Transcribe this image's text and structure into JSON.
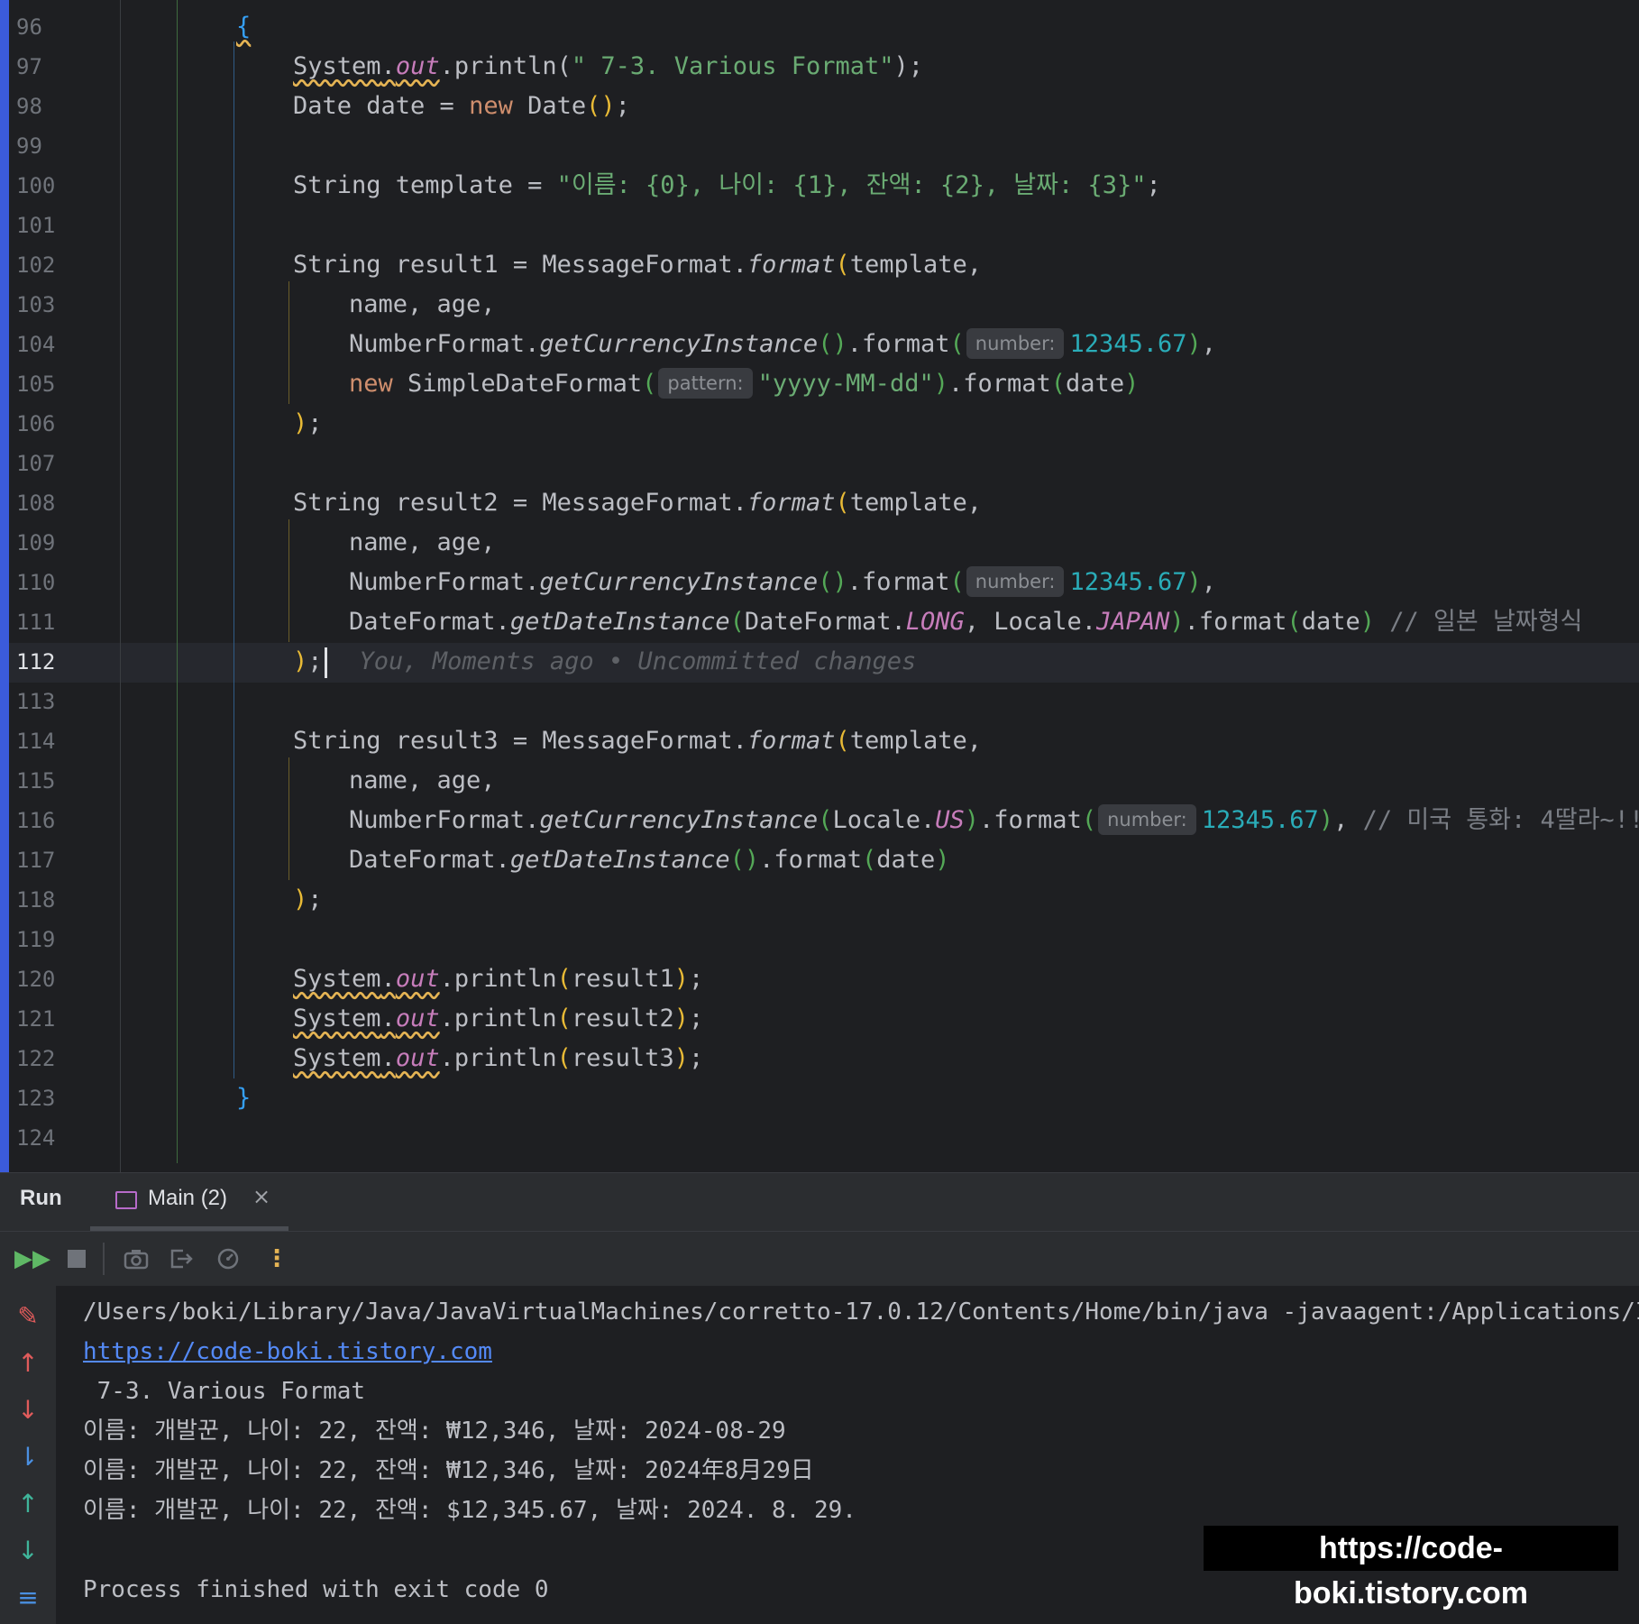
{
  "editor": {
    "line_numbers": [
      "96",
      "97",
      "98",
      "99",
      "100",
      "101",
      "102",
      "103",
      "104",
      "105",
      "106",
      "107",
      "108",
      "109",
      "110",
      "111",
      "112",
      "113",
      "114",
      "115",
      "116",
      "117",
      "118",
      "119",
      "120",
      "121",
      "122",
      "123",
      "124"
    ],
    "current_line": "112",
    "blame_hint": "You, Moments ago • Uncommitted changes",
    "inlay_hints": {
      "number": "number:",
      "pattern": "pattern:"
    },
    "lines": {
      "l96": "{",
      "l97": [
        "System",
        ".",
        "out",
        ".println(",
        "\" 7-3. Various Format\"",
        ");"
      ],
      "l98": [
        "Date date = ",
        "new",
        " Date",
        "()",
        ";"
      ],
      "l100": [
        "String template = ",
        "\"이름: {0}, 나이: {1}, 잔액: {2}, 날짜: {3}\"",
        ";"
      ],
      "l102": [
        "String result1 = MessageFormat.",
        "format",
        "(",
        "template,"
      ],
      "l103": "name, age,",
      "l104": [
        "NumberFormat.",
        "getCurrencyInstance",
        "()",
        ".format",
        "(",
        "12345.67",
        ")",
        ","
      ],
      "l105": [
        "new",
        " SimpleDateFormat",
        "(",
        "\"yyyy-MM-dd\"",
        ")",
        ".format",
        "(",
        "date",
        ")"
      ],
      "l106": [
        ")",
        ";"
      ],
      "l108": [
        "String result2 = MessageFormat.",
        "format",
        "(",
        "template,"
      ],
      "l109": "name, age,",
      "l110": [
        "NumberFormat.",
        "getCurrencyInstance",
        "()",
        ".format",
        "(",
        "12345.67",
        ")",
        ","
      ],
      "l111": [
        "DateFormat.",
        "getDateInstance",
        "(",
        "DateFormat.",
        "LONG",
        ", Locale.",
        "JAPAN",
        ")",
        ".format",
        "(",
        "date",
        ")",
        " // 일본 날짜형식"
      ],
      "l112": [
        ")",
        ";"
      ],
      "l114": [
        "String result3 = MessageFormat.",
        "format",
        "(",
        "template,"
      ],
      "l115": "name, age,",
      "l116": [
        "NumberFormat.",
        "getCurrencyInstance",
        "(",
        "Locale.",
        "US",
        ")",
        ".format",
        "(",
        "12345.67",
        ")",
        ", ",
        "// 미국 통화: 4딸라~!!"
      ],
      "l117": [
        "DateFormat.",
        "getDateInstance",
        "()",
        ".format",
        "(",
        "date",
        ")"
      ],
      "l118": [
        ")",
        ";"
      ],
      "l120": [
        "System",
        ".",
        "out",
        ".println",
        "(",
        "result1",
        ")",
        ";"
      ],
      "l121": [
        "System",
        ".",
        "out",
        ".println",
        "(",
        "result2",
        ")",
        ";"
      ],
      "l122": [
        "System",
        ".",
        "out",
        ".println",
        "(",
        "result3",
        ")",
        ";"
      ],
      "l123": "}"
    }
  },
  "run_panel": {
    "title": "Run",
    "tab_label": "Main (2)",
    "tab_close": "×",
    "toolbar_icons": [
      "rerun-icon",
      "stop-icon",
      "screenshot-icon",
      "exit-icon",
      "profiler-icon",
      "more-icon"
    ],
    "side_icons": [
      "clear-icon",
      "up-arrow-red-icon",
      "down-arrow-red-icon",
      "sort-icon",
      "up-arrow-icon",
      "down-arrow-icon",
      "soft-wrap-icon"
    ],
    "output": [
      "/Users/boki/Library/Java/JavaVirtualMachines/corretto-17.0.12/Contents/Home/bin/java -javaagent:/Applications/I",
      "https://code-boki.tistory.com",
      " 7-3. Various Format",
      "이름: 개발꾼, 나이: 22, 잔액: ₩12,346, 날짜: 2024-08-29",
      "이름: 개발꾼, 나이: 22, 잔액: ₩12,346, 날짜: 2024年8月29日",
      "이름: 개발꾼, 나이: 22, 잔액: $12,345.67, 날짜: 2024. 8. 29.",
      "",
      "Process finished with exit code 0"
    ]
  },
  "watermark": "https://code-boki.tistory.com",
  "colors": {
    "background": "#1e1f22",
    "keyword": "#cf8e6d",
    "string": "#6aab73",
    "number": "#2aacb8",
    "field": "#c77dbb",
    "link": "#548af7"
  }
}
